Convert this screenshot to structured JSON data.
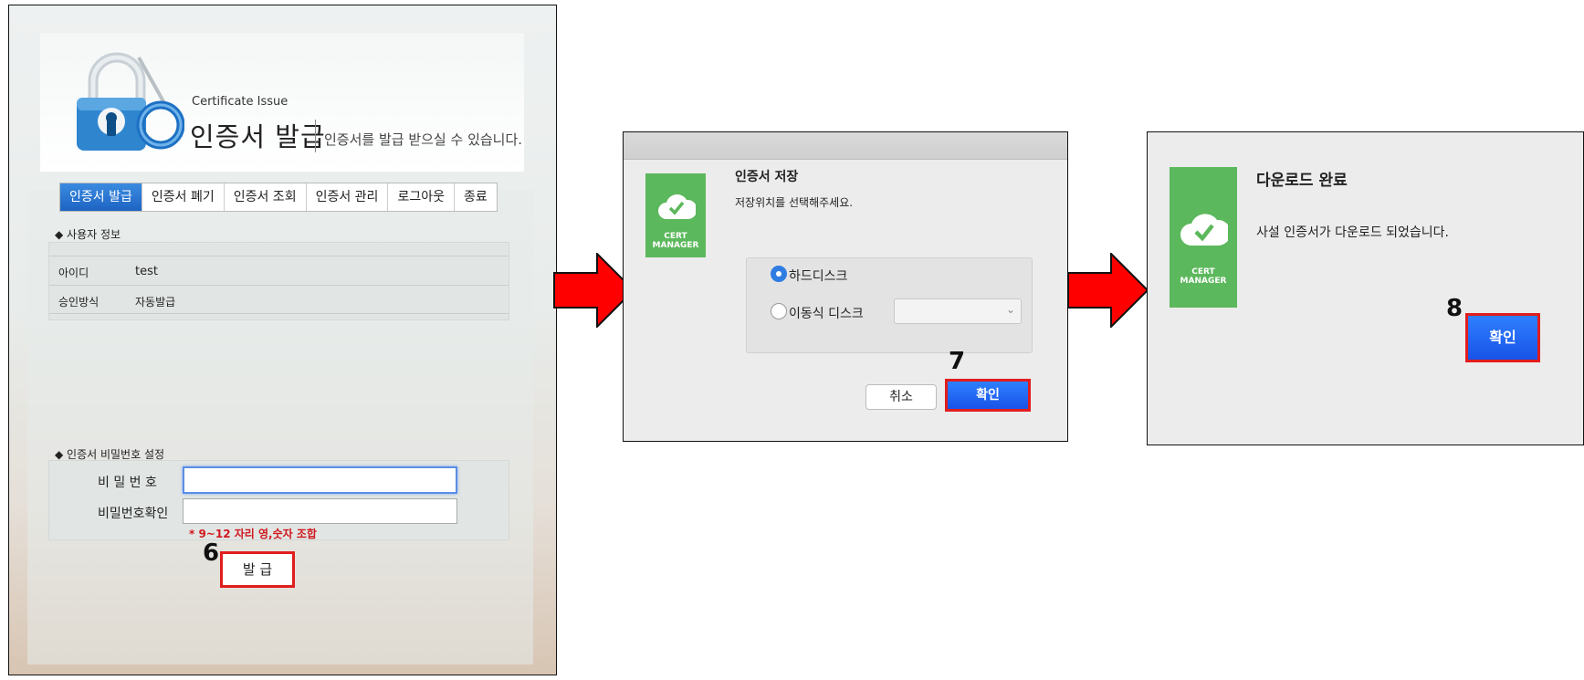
{
  "panel1": {
    "header": {
      "eng_title": "Certificate Issue",
      "title": "인증서 발급",
      "subtitle": "인증서를 발급 받으실 수 있습니다."
    },
    "tabs": [
      "인증서 발급",
      "인증서 폐기",
      "인증서 조회",
      "인증서 관리",
      "로그아웃",
      "종료"
    ],
    "user_section": {
      "title": "◆ 사용자 정보",
      "rows": [
        {
          "label": "아이디",
          "value": "test"
        },
        {
          "label": "승인방식",
          "value": "자동발급"
        }
      ]
    },
    "password_section": {
      "title": "◆ 인증서 비밀번호 설정",
      "password_label": "비 밀 번 호",
      "confirm_label": "비밀번호확인",
      "password_value": "",
      "confirm_value": "",
      "hint": "* 9~12 자리 영,숫자 조합"
    },
    "issue_button": "발 급",
    "step": "6"
  },
  "panel2": {
    "logo_text": "CERT MANAGER",
    "title": "인증서 저장",
    "subtitle": "저장위치를 선택해주세요.",
    "options": [
      {
        "label": "하드디스크",
        "checked": true
      },
      {
        "label": "이동식 디스크",
        "checked": false
      }
    ],
    "select_value": "",
    "cancel_label": "취소",
    "ok_label": "확인",
    "step": "7"
  },
  "panel3": {
    "logo_text": "CERT MANAGER",
    "title": "다운로드 완료",
    "message": "사설 인증서가 다운로드 되었습니다.",
    "ok_label": "확인",
    "step": "8"
  },
  "colors": {
    "accent_blue": "#1e63c3",
    "highlight_red": "#e11d1d",
    "arrow_red": "#ff0000",
    "cert_green": "#5cb85c"
  }
}
